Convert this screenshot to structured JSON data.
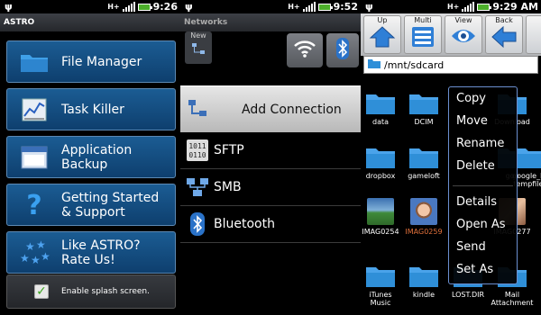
{
  "panels": [
    {
      "status": {
        "time": "9:26",
        "network": "H+"
      },
      "app_title": "ASTRO",
      "menu": [
        {
          "label": "File Manager",
          "icon": "folder-icon"
        },
        {
          "label": "Task Killer",
          "icon": "chart-icon"
        },
        {
          "label": "Application Backup",
          "icon": "window-icon"
        },
        {
          "label": "Getting Started & Support",
          "icon": "question-icon"
        },
        {
          "label": "Like ASTRO? Rate Us!",
          "icon": "stars-icon"
        }
      ],
      "splash_label": "Enable splash screen.",
      "splash_checked": true
    },
    {
      "status": {
        "time": "9:52",
        "network": "H+"
      },
      "screen_title": "Networks",
      "new_label": "New",
      "context_menu": {
        "title": "Add Connection",
        "items": [
          {
            "label": "SFTP",
            "icon": "binary-icon"
          },
          {
            "label": "SMB",
            "icon": "network-icon"
          },
          {
            "label": "Bluetooth",
            "icon": "bluetooth-icon"
          }
        ]
      }
    },
    {
      "status": {
        "time": "9:29 AM",
        "network": "H+"
      },
      "toolbar": [
        {
          "label": "Up",
          "icon": "home-up-icon"
        },
        {
          "label": "Multi",
          "icon": "list-icon"
        },
        {
          "label": "View",
          "icon": "eye-icon"
        },
        {
          "label": "Back",
          "icon": "back-arrow-icon"
        }
      ],
      "path": "/mnt/sdcard",
      "files": [
        {
          "name": "data"
        },
        {
          "name": "DCIM"
        },
        {
          "name": "Download"
        },
        {
          "name": "dropbox"
        },
        {
          "name": "gameloft"
        },
        {
          "name": "goo"
        },
        {
          "name": "google_kwk tempfiles"
        },
        {
          "name": "IMAG0254"
        },
        {
          "name": "IMAG0259"
        },
        {
          "name": "IMAG0277"
        },
        {
          "name": "iTunes Music"
        },
        {
          "name": "kindle"
        },
        {
          "name": "LOST.DIR"
        },
        {
          "name": "Mail Attachment"
        }
      ],
      "popup_menu": [
        "Copy",
        "Move",
        "Rename",
        "Delete",
        "Details",
        "Open As",
        "Send",
        "Set As"
      ]
    }
  ],
  "colors": {
    "accent_blue": "#1b5c93",
    "folder_blue": "#2f8fd8",
    "highlight_orange": "#e0703b",
    "check_green": "#3aa51f"
  }
}
